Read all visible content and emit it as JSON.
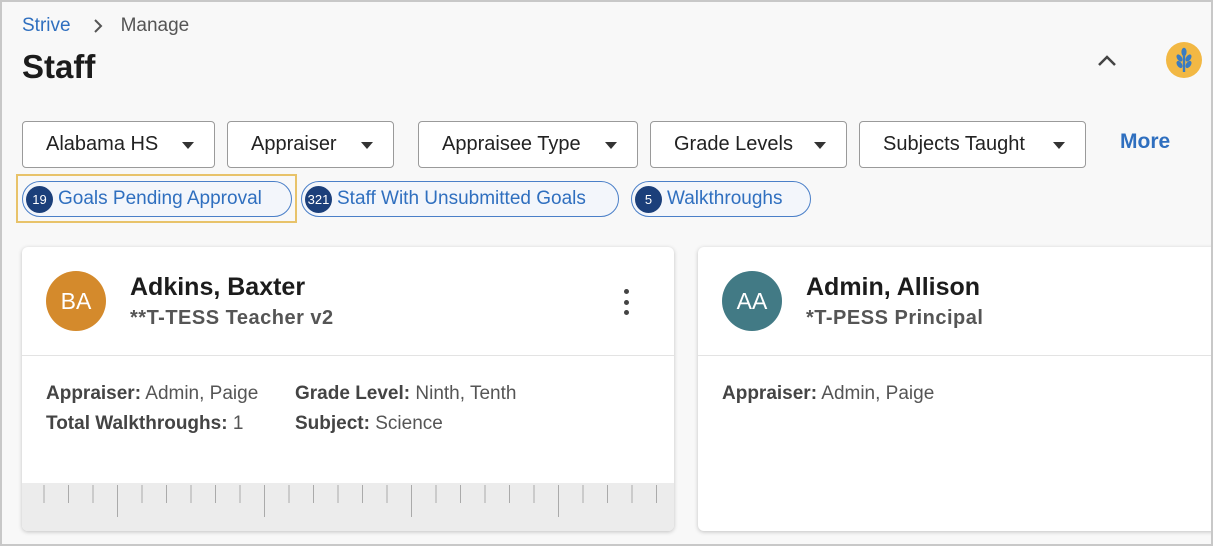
{
  "breadcrumb": {
    "root": "Strive",
    "current": "Manage"
  },
  "page_title": "Staff",
  "colors": {
    "accent": "#2f6fbf",
    "chip_badge": "#1b3f7a",
    "highlight": "#e8c36a"
  },
  "filters": [
    {
      "label": "Alabama HS"
    },
    {
      "label": "Appraiser"
    },
    {
      "label": "Appraisee Type"
    },
    {
      "label": "Grade Levels"
    },
    {
      "label": "Subjects Taught"
    }
  ],
  "more_label": "More",
  "chips": [
    {
      "count": "19",
      "label": "Goals Pending Approval"
    },
    {
      "count": "321",
      "label": "Staff With Unsubmitted Goals"
    },
    {
      "count": "5",
      "label": "Walkthroughs"
    }
  ],
  "cards": [
    {
      "initials": "BA",
      "avatar_color": "#d48a2c",
      "name": "Adkins, Baxter",
      "role": "**T-TESS Teacher v2",
      "appraiser_label": "Appraiser:",
      "appraiser": "Admin, Paige",
      "walkthroughs_label": "Total Walkthroughs:",
      "walkthroughs": "1",
      "grade_label": "Grade Level:",
      "grade": "Ninth, Tenth",
      "subject_label": "Subject:",
      "subject": "Science"
    },
    {
      "initials": "AA",
      "avatar_color": "#427a85",
      "name": "Admin, Allison",
      "role": "*T-PESS Principal",
      "appraiser_label": "Appraiser:",
      "appraiser": "Admin, Paige"
    }
  ]
}
